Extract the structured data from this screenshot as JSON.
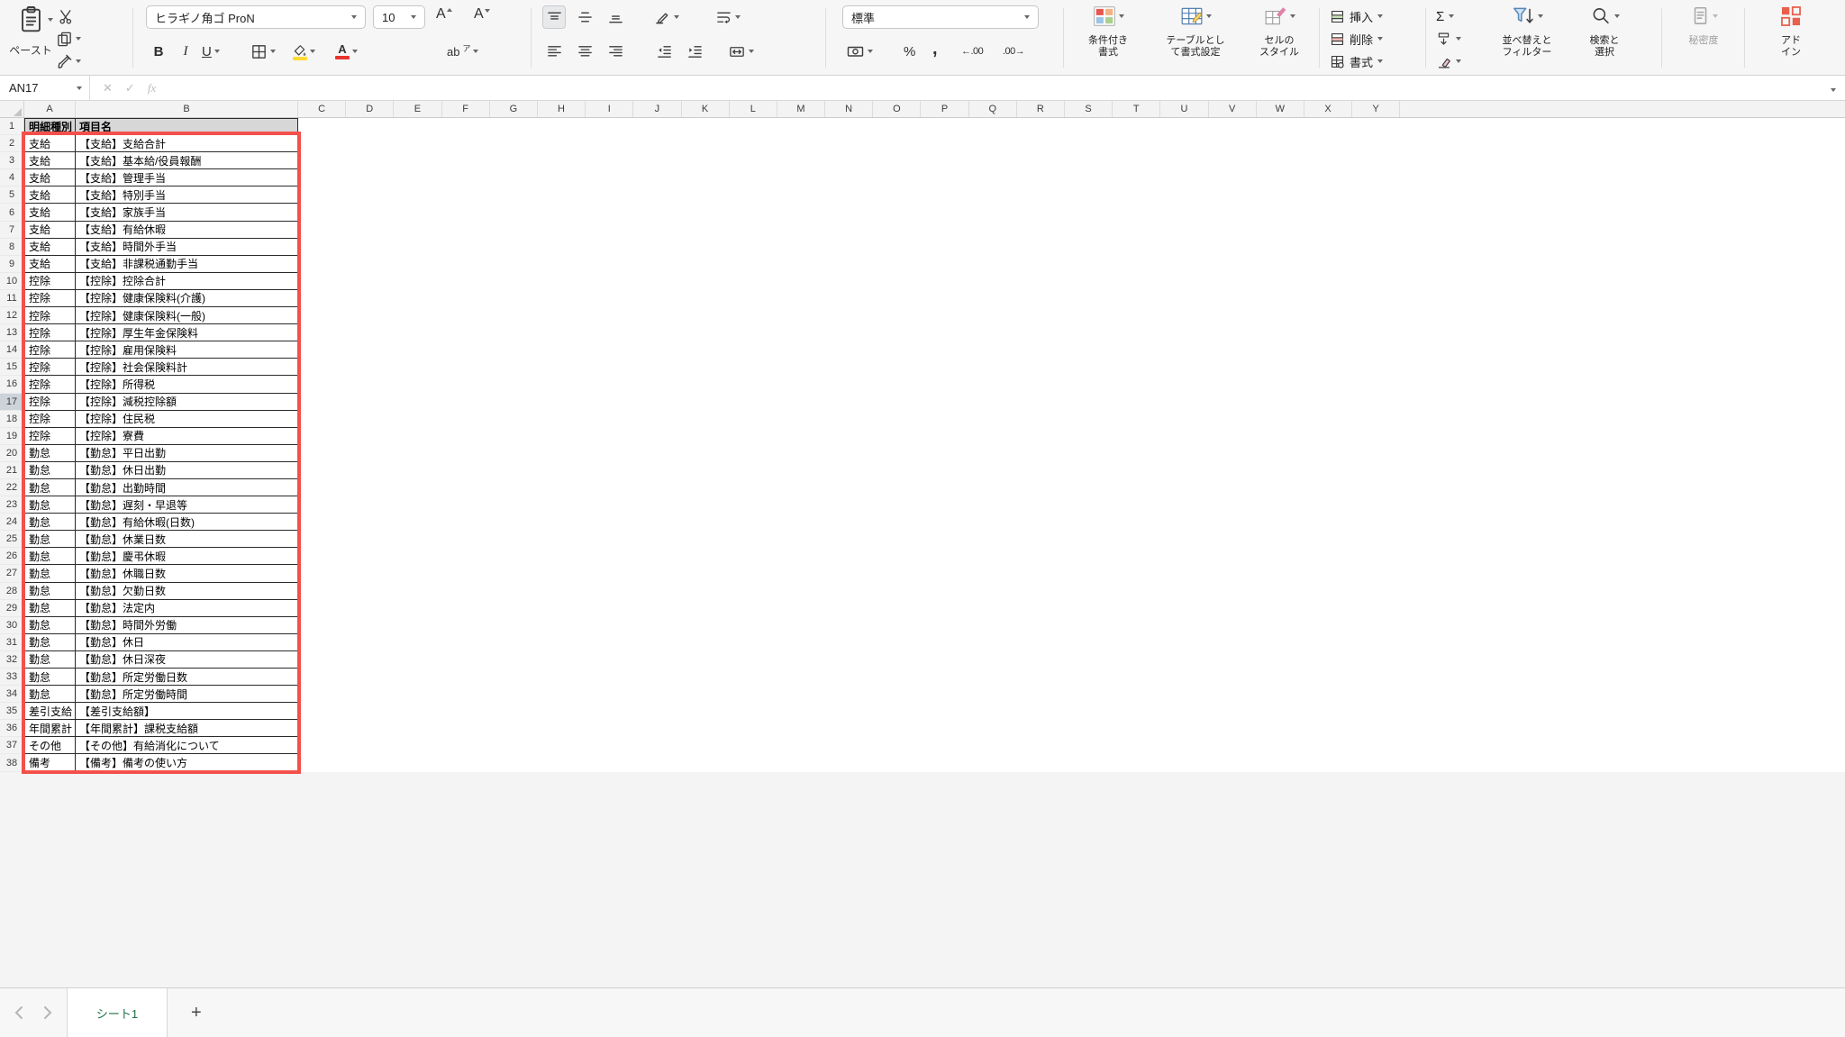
{
  "colors": {
    "excel_green": "#1E7145",
    "annotation_red": "#F4504B",
    "fill_yellow": "#FFDA33",
    "font_red": "#E8352E",
    "addin_red": "#E8604C"
  },
  "ribbon": {
    "clipboard": {
      "paste": "ペースト"
    },
    "font": {
      "name": "ヒラギノ角ゴ ProN",
      "size": "10",
      "bold": "B",
      "italic": "I",
      "underline": "U",
      "grow": "A",
      "shrink": "A",
      "color_letter": "A",
      "phonetic_main": "ab",
      "phonetic_sub": "ア"
    },
    "number": {
      "format": "標準",
      "percent": "%",
      "comma": ",",
      "inc_decimal": "←.00",
      "dec_decimal": ".00→"
    },
    "styles": {
      "conditional": [
        "条件付き",
        "書式"
      ],
      "format_table": [
        "テーブルとし",
        "て書式設定"
      ],
      "cell_styles": [
        "セルの",
        "スタイル"
      ]
    },
    "cells": {
      "insert": "挿入",
      "delete": "削除",
      "format": "書式"
    },
    "editing": {
      "autosum": "Σ",
      "sort_filter": [
        "並べ替えと",
        "フィルター"
      ],
      "find_select": [
        "検索と",
        "選択"
      ]
    },
    "sensitivity": "秘密度",
    "addins": [
      "アド",
      "イン"
    ]
  },
  "formula_bar": {
    "name_box": "AN17",
    "cancel": "✕",
    "enter": "✓",
    "fx": "fx"
  },
  "sheet": {
    "columns": [
      "A",
      "B",
      "C",
      "D",
      "E",
      "F",
      "G",
      "H",
      "I",
      "J",
      "K",
      "L",
      "M",
      "N",
      "O",
      "P",
      "Q",
      "R",
      "S",
      "T",
      "U",
      "V",
      "W",
      "X",
      "Y"
    ],
    "selected_row": 17,
    "rows": [
      {
        "n": 1,
        "type": "明細種別",
        "name": "項目名",
        "header": true
      },
      {
        "n": 2,
        "type": "支給",
        "name": "【支給】支給合計"
      },
      {
        "n": 3,
        "type": "支給",
        "name": "【支給】基本給/役員報酬"
      },
      {
        "n": 4,
        "type": "支給",
        "name": "【支給】管理手当"
      },
      {
        "n": 5,
        "type": "支給",
        "name": "【支給】特別手当"
      },
      {
        "n": 6,
        "type": "支給",
        "name": "【支給】家族手当"
      },
      {
        "n": 7,
        "type": "支給",
        "name": "【支給】有給休暇"
      },
      {
        "n": 8,
        "type": "支給",
        "name": "【支給】時間外手当"
      },
      {
        "n": 9,
        "type": "支給",
        "name": "【支給】非課税通勤手当"
      },
      {
        "n": 10,
        "type": "控除",
        "name": "【控除】控除合計"
      },
      {
        "n": 11,
        "type": "控除",
        "name": "【控除】健康保険料(介護)"
      },
      {
        "n": 12,
        "type": "控除",
        "name": "【控除】健康保険料(一般)"
      },
      {
        "n": 13,
        "type": "控除",
        "name": "【控除】厚生年金保険料"
      },
      {
        "n": 14,
        "type": "控除",
        "name": "【控除】雇用保険料"
      },
      {
        "n": 15,
        "type": "控除",
        "name": "【控除】社会保険料計"
      },
      {
        "n": 16,
        "type": "控除",
        "name": "【控除】所得税"
      },
      {
        "n": 17,
        "type": "控除",
        "name": "【控除】減税控除額"
      },
      {
        "n": 18,
        "type": "控除",
        "name": "【控除】住民税"
      },
      {
        "n": 19,
        "type": "控除",
        "name": "【控除】寮費"
      },
      {
        "n": 20,
        "type": "勤怠",
        "name": "【勤怠】平日出勤"
      },
      {
        "n": 21,
        "type": "勤怠",
        "name": "【勤怠】休日出勤"
      },
      {
        "n": 22,
        "type": "勤怠",
        "name": "【勤怠】出勤時間"
      },
      {
        "n": 23,
        "type": "勤怠",
        "name": "【勤怠】遅刻・早退等"
      },
      {
        "n": 24,
        "type": "勤怠",
        "name": "【勤怠】有給休暇(日数)"
      },
      {
        "n": 25,
        "type": "勤怠",
        "name": "【勤怠】休業日数"
      },
      {
        "n": 26,
        "type": "勤怠",
        "name": "【勤怠】慶弔休暇"
      },
      {
        "n": 27,
        "type": "勤怠",
        "name": "【勤怠】休職日数"
      },
      {
        "n": 28,
        "type": "勤怠",
        "name": "【勤怠】欠勤日数"
      },
      {
        "n": 29,
        "type": "勤怠",
        "name": "【勤怠】法定内"
      },
      {
        "n": 30,
        "type": "勤怠",
        "name": "【勤怠】時間外労働"
      },
      {
        "n": 31,
        "type": "勤怠",
        "name": "【勤怠】休日"
      },
      {
        "n": 32,
        "type": "勤怠",
        "name": "【勤怠】休日深夜"
      },
      {
        "n": 33,
        "type": "勤怠",
        "name": "【勤怠】所定労働日数"
      },
      {
        "n": 34,
        "type": "勤怠",
        "name": "【勤怠】所定労働時間"
      },
      {
        "n": 35,
        "type": "差引支給",
        "name": "【差引支給額】"
      },
      {
        "n": 36,
        "type": "年間累計",
        "name": "【年間累計】課税支給額"
      },
      {
        "n": 37,
        "type": "その他",
        "name": "【その他】有給消化について"
      },
      {
        "n": 38,
        "type": "備考",
        "name": "【備考】備考の使い方"
      }
    ]
  },
  "tab_bar": {
    "active_tab": "シート1",
    "add": "+"
  }
}
